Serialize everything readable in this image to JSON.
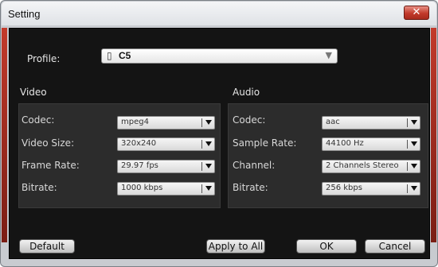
{
  "window": {
    "title": "Setting",
    "close_glyph": "✕"
  },
  "profile": {
    "label": "Profile:",
    "value": "C5",
    "icon": "device-icon",
    "icon_glyph": "▯"
  },
  "video": {
    "title": "Video",
    "rows": [
      {
        "label": "Codec:",
        "value": "mpeg4"
      },
      {
        "label": "Video Size:",
        "value": "320x240"
      },
      {
        "label": "Frame Rate:",
        "value": "29.97 fps"
      },
      {
        "label": "Bitrate:",
        "value": "1000 kbps"
      }
    ]
  },
  "audio": {
    "title": "Audio",
    "rows": [
      {
        "label": "Codec:",
        "value": "aac"
      },
      {
        "label": "Sample Rate:",
        "value": "44100 Hz"
      },
      {
        "label": "Channel:",
        "value": "2 Channels Stereo"
      },
      {
        "label": "Bitrate:",
        "value": "256 kbps"
      }
    ]
  },
  "buttons": {
    "default": "Default",
    "apply_all": "Apply to All",
    "ok": "OK",
    "cancel": "Cancel"
  },
  "colors": {
    "accent": "#c23a2b",
    "panel": "#141414",
    "group": "#2c2c2c"
  }
}
